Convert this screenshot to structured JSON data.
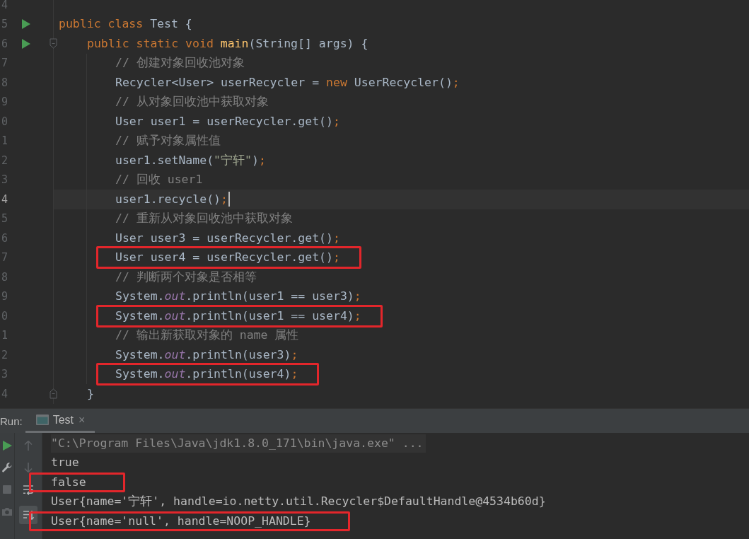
{
  "editor": {
    "lines": [
      {
        "number": "4",
        "kind": "plain",
        "runnable": false,
        "current": false,
        "highlighted": false
      },
      {
        "number": "5",
        "kind": "plain",
        "runnable": true,
        "current": false,
        "highlighted": false,
        "tokens": [
          {
            "kind": "keyword",
            "text": "public class "
          },
          {
            "kind": "plain",
            "text": "Test {"
          }
        ],
        "children": [
          {
            "number": "6",
            "kind": "fold-start",
            "runnable": true,
            "current": false,
            "highlighted": false,
            "tokens": [
              {
                "kind": "keyword",
                "text": "public static void "
              },
              {
                "kind": "method",
                "text": "main"
              },
              {
                "kind": "plain",
                "text": "(String[] args) {"
              }
            ],
            "children": [
              {
                "number": "7",
                "kind": "plain",
                "runnable": false,
                "current": false,
                "highlighted": false,
                "tokens": [
                  {
                    "kind": "comment",
                    "text": "// 创建对象回收池对象"
                  }
                ]
              },
              {
                "number": "8",
                "kind": "plain",
                "runnable": false,
                "current": false,
                "highlighted": false,
                "tokens": [
                  {
                    "kind": "plain",
                    "text": "Recycler<User> userRecycler = "
                  },
                  {
                    "kind": "keyword",
                    "text": "new"
                  },
                  {
                    "kind": "plain",
                    "text": " UserRecycler()"
                  },
                  {
                    "kind": "semicolon",
                    "text": ";"
                  }
                ]
              },
              {
                "number": "9",
                "kind": "plain",
                "runnable": false,
                "current": false,
                "highlighted": false,
                "tokens": [
                  {
                    "kind": "comment",
                    "text": "// 从对象回收池中获取对象"
                  }
                ]
              },
              {
                "number": "0",
                "kind": "plain",
                "runnable": false,
                "current": false,
                "highlighted": false,
                "tokens": [
                  {
                    "kind": "plain",
                    "text": "User user1 = userRecycler.get()"
                  },
                  {
                    "kind": "semicolon",
                    "text": ";"
                  }
                ]
              },
              {
                "number": "1",
                "kind": "plain",
                "runnable": false,
                "current": false,
                "highlighted": false,
                "tokens": [
                  {
                    "kind": "comment",
                    "text": "// 赋予对象属性值"
                  }
                ]
              },
              {
                "number": "2",
                "kind": "plain",
                "runnable": false,
                "current": false,
                "highlighted": false,
                "tokens": [
                  {
                    "kind": "plain",
                    "text": "user1.setName("
                  },
                  {
                    "kind": "string",
                    "text": "\"宁轩\""
                  },
                  {
                    "kind": "plain",
                    "text": ")"
                  },
                  {
                    "kind": "semicolon",
                    "text": ";"
                  }
                ]
              },
              {
                "number": "3",
                "kind": "plain",
                "runnable": false,
                "current": false,
                "highlighted": false,
                "tokens": [
                  {
                    "kind": "comment",
                    "text": "// 回收 user1"
                  }
                ]
              },
              {
                "number": "4",
                "kind": "plain",
                "runnable": false,
                "current": true,
                "highlighted": false,
                "tokens": [
                  {
                    "kind": "plain",
                    "text": "user1.recycle()"
                  },
                  {
                    "kind": "semicolon",
                    "text": ";"
                  }
                ]
              },
              {
                "number": "5",
                "kind": "plain",
                "runnable": false,
                "current": false,
                "highlighted": false,
                "tokens": [
                  {
                    "kind": "comment",
                    "text": "// 重新从对象回收池中获取对象"
                  }
                ]
              },
              {
                "number": "6",
                "kind": "plain",
                "runnable": false,
                "current": false,
                "highlighted": false,
                "tokens": [
                  {
                    "kind": "plain",
                    "text": "User user3 = userRecycler.get()"
                  },
                  {
                    "kind": "semicolon",
                    "text": ";"
                  }
                ]
              },
              {
                "number": "7",
                "kind": "plain",
                "runnable": false,
                "current": false,
                "highlighted": true,
                "tokens": [
                  {
                    "kind": "plain",
                    "text": "User user4 = userRecycler.get()"
                  },
                  {
                    "kind": "semicolon",
                    "text": ";"
                  }
                ]
              },
              {
                "number": "8",
                "kind": "plain",
                "runnable": false,
                "current": false,
                "highlighted": false,
                "tokens": [
                  {
                    "kind": "comment",
                    "text": "// 判断两个对象是否相等"
                  }
                ]
              },
              {
                "number": "9",
                "kind": "plain",
                "runnable": false,
                "current": false,
                "highlighted": false,
                "tokens": [
                  {
                    "kind": "plain",
                    "text": "System."
                  },
                  {
                    "kind": "field",
                    "text": "out"
                  },
                  {
                    "kind": "plain",
                    "text": ".println(user1 == user3)"
                  },
                  {
                    "kind": "semicolon",
                    "text": ";"
                  }
                ]
              },
              {
                "number": "0",
                "kind": "plain",
                "runnable": false,
                "current": false,
                "highlighted": true,
                "tokens": [
                  {
                    "kind": "plain",
                    "text": "System."
                  },
                  {
                    "kind": "field",
                    "text": "out"
                  },
                  {
                    "kind": "plain",
                    "text": ".println(user1 == user4)"
                  },
                  {
                    "kind": "semicolon",
                    "text": ";"
                  }
                ]
              },
              {
                "number": "1",
                "kind": "plain",
                "runnable": false,
                "current": false,
                "highlighted": false,
                "tokens": [
                  {
                    "kind": "comment",
                    "text": "// 输出新获取对象的 name 属性"
                  }
                ]
              },
              {
                "number": "2",
                "kind": "plain",
                "runnable": false,
                "current": false,
                "highlighted": false,
                "tokens": [
                  {
                    "kind": "plain",
                    "text": "System."
                  },
                  {
                    "kind": "field",
                    "text": "out"
                  },
                  {
                    "kind": "plain",
                    "text": ".println(user3)"
                  },
                  {
                    "kind": "semicolon",
                    "text": ";"
                  }
                ]
              },
              {
                "number": "3",
                "kind": "plain",
                "runnable": false,
                "current": false,
                "highlighted": true,
                "tokens": [
                  {
                    "kind": "plain",
                    "text": "System."
                  },
                  {
                    "kind": "field",
                    "text": "out"
                  },
                  {
                    "kind": "plain",
                    "text": ".println(user4)"
                  },
                  {
                    "kind": "semicolon",
                    "text": ";"
                  }
                ]
              }
            ]
          },
          {
            "number": "4",
            "kind": "fold-end",
            "runnable": false,
            "current": false,
            "highlighted": false,
            "tokens": [
              {
                "kind": "plain",
                "text": "}"
              }
            ]
          }
        ]
      }
    ]
  },
  "run_panel": {
    "label": "Run:",
    "tabs": [
      {
        "label": "Test",
        "close": "×",
        "selected": true
      }
    ],
    "left_tools": [
      {
        "kind": "rerun",
        "disabled": false
      },
      {
        "kind": "settings",
        "disabled": false
      },
      {
        "kind": "stop",
        "disabled": true
      },
      {
        "kind": "snapshot",
        "disabled": true
      }
    ],
    "right_tools": [
      {
        "kind": "previous",
        "disabled": true,
        "pressed": false
      },
      {
        "kind": "next",
        "disabled": true,
        "pressed": false
      },
      {
        "kind": "soft-wrap",
        "disabled": false,
        "pressed": false
      },
      {
        "kind": "scroll-to-end",
        "disabled": false,
        "pressed": true
      }
    ],
    "console": [
      {
        "kind": "command",
        "text": "\"C:\\Program Files\\Java\\jdk1.8.0_171\\bin\\java.exe\" ...",
        "highlighted": false
      },
      {
        "kind": "output",
        "text": "true",
        "highlighted": false
      },
      {
        "kind": "output",
        "text": "false",
        "highlighted": true
      },
      {
        "kind": "output",
        "text": "User{name='宁轩', handle=io.netty.util.Recycler$DefaultHandle@4534b60d}",
        "highlighted": false
      },
      {
        "kind": "output",
        "text": "User{name='null', handle=NOOP_HANDLE}",
        "highlighted": true
      }
    ]
  }
}
